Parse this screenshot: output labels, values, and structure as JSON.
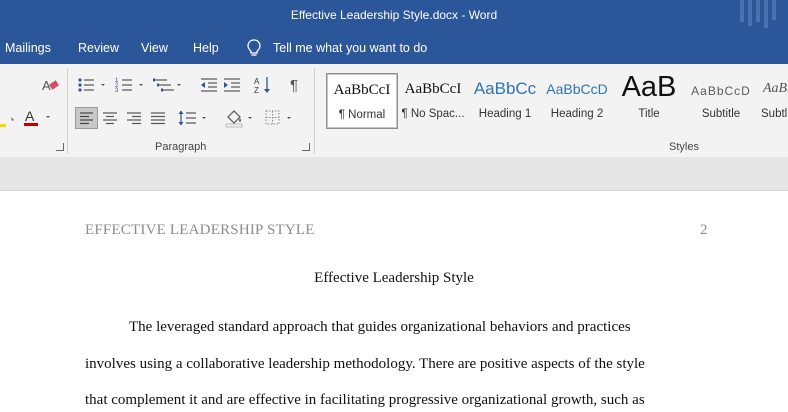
{
  "window": {
    "title": "Effective Leadership Style.docx  -  Word"
  },
  "menu": {
    "items": [
      "Mailings",
      "Review",
      "View",
      "Help"
    ],
    "tell_me": "Tell me what you want to do"
  },
  "ribbon": {
    "paragraph_label": "Paragraph",
    "styles_label": "Styles",
    "styles": [
      {
        "sample": "AaBbCcI",
        "name": "¶ Normal"
      },
      {
        "sample": "AaBbCcI",
        "name": "¶ No Spac..."
      },
      {
        "sample": "AaBbCc",
        "name": "Heading 1"
      },
      {
        "sample": "AaBbCcD",
        "name": "Heading 2"
      },
      {
        "sample": "AaB",
        "name": "Title"
      },
      {
        "sample": "AaBbCcD",
        "name": "Subtitle"
      },
      {
        "sample": "AaBb",
        "name": "Subtl"
      }
    ]
  },
  "document": {
    "running_header": "EFFECTIVE LEADERSHIP STYLE",
    "page_number": "2",
    "title": "Effective Leadership Style",
    "lines": [
      "The leveraged standard approach that guides organizational behaviors and practices",
      "involves using a collaborative leadership methodology. There are positive aspects of the style",
      "that complement it and are effective in facilitating progressive organizational growth, such as"
    ]
  },
  "colors": {
    "accent": "#2b579a",
    "ribbon": "#f3f3f3",
    "heading_blue": "#2e74b5",
    "font_red": "#c00000"
  }
}
